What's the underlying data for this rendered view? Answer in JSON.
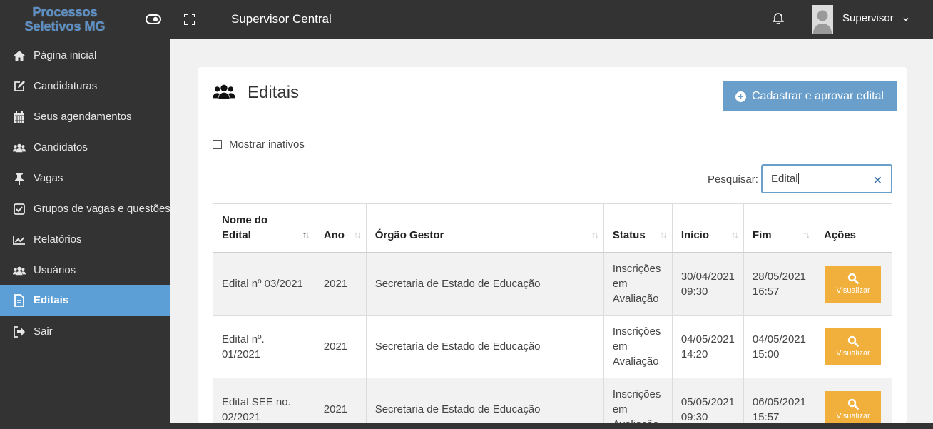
{
  "app": {
    "logo_line1": "Processos",
    "logo_line2": "Seletivos MG",
    "top_title": "Supervisor Central",
    "user_name": "Supervisor"
  },
  "sidebar": {
    "items": [
      {
        "label": "Página inicial",
        "icon": "home-icon"
      },
      {
        "label": "Candidaturas",
        "icon": "edit-icon"
      },
      {
        "label": "Seus agendamentos",
        "icon": "calendar-icon"
      },
      {
        "label": "Candidatos",
        "icon": "users-icon"
      },
      {
        "label": "Vagas",
        "icon": "pin-icon"
      },
      {
        "label": "Grupos de vagas e questões",
        "icon": "check-square-icon"
      },
      {
        "label": "Relatórios",
        "icon": "chart-icon"
      },
      {
        "label": "Usuários",
        "icon": "users-icon"
      },
      {
        "label": "Editais",
        "icon": "file-icon",
        "active": true
      },
      {
        "label": "Sair",
        "icon": "sign-out-icon"
      }
    ]
  },
  "page": {
    "title": "Editais",
    "primary_button": "Cadastrar e aprovar edital",
    "show_inactive_label": "Mostrar inativos",
    "search_label": "Pesquisar:",
    "search_value": "Edital"
  },
  "table": {
    "columns": {
      "nome_line1": "Nome do",
      "nome_line2": "Edital",
      "ano": "Ano",
      "orgao": "Órgão Gestor",
      "status": "Status",
      "inicio": "Início",
      "fim": "Fim",
      "acoes": "Ações"
    },
    "rows": [
      {
        "nome": "Edital nº 03/2021",
        "ano": "2021",
        "orgao": "Secretaria de Estado de Educação",
        "status_1": "Inscrições",
        "status_2": "em",
        "status_3": "Avaliação",
        "inicio_date": "30/04/2021",
        "inicio_time": "09:30",
        "fim_date": "28/05/2021",
        "fim_time": "16:57",
        "action": "Visualizar"
      },
      {
        "nome": "Edital nº. 01/2021",
        "ano": "2021",
        "orgao": "Secretaria de Estado de Educação",
        "status_1": "Inscrições",
        "status_2": "em",
        "status_3": "Avaliação",
        "inicio_date": "04/05/2021",
        "inicio_time": "14:20",
        "fim_date": "04/05/2021",
        "fim_time": "15:00",
        "action": "Visualizar"
      },
      {
        "nome_line1": "Edital SEE no.",
        "nome_line2": "02/2021",
        "ano": "2021",
        "orgao": "Secretaria de Estado de Educação",
        "status_1": "Inscrições",
        "status_2": "em",
        "status_3": "Avaliação",
        "inicio_date": "05/05/2021",
        "inicio_time": "09:30",
        "fim_date": "06/05/2021",
        "fim_time": "15:57",
        "action": "Visualizar"
      }
    ]
  },
  "colors": {
    "topbar": "#333333",
    "sidebar_active": "#5b9fd6",
    "primary_button": "#6a9fcc",
    "action_button": "#f0b03b"
  }
}
